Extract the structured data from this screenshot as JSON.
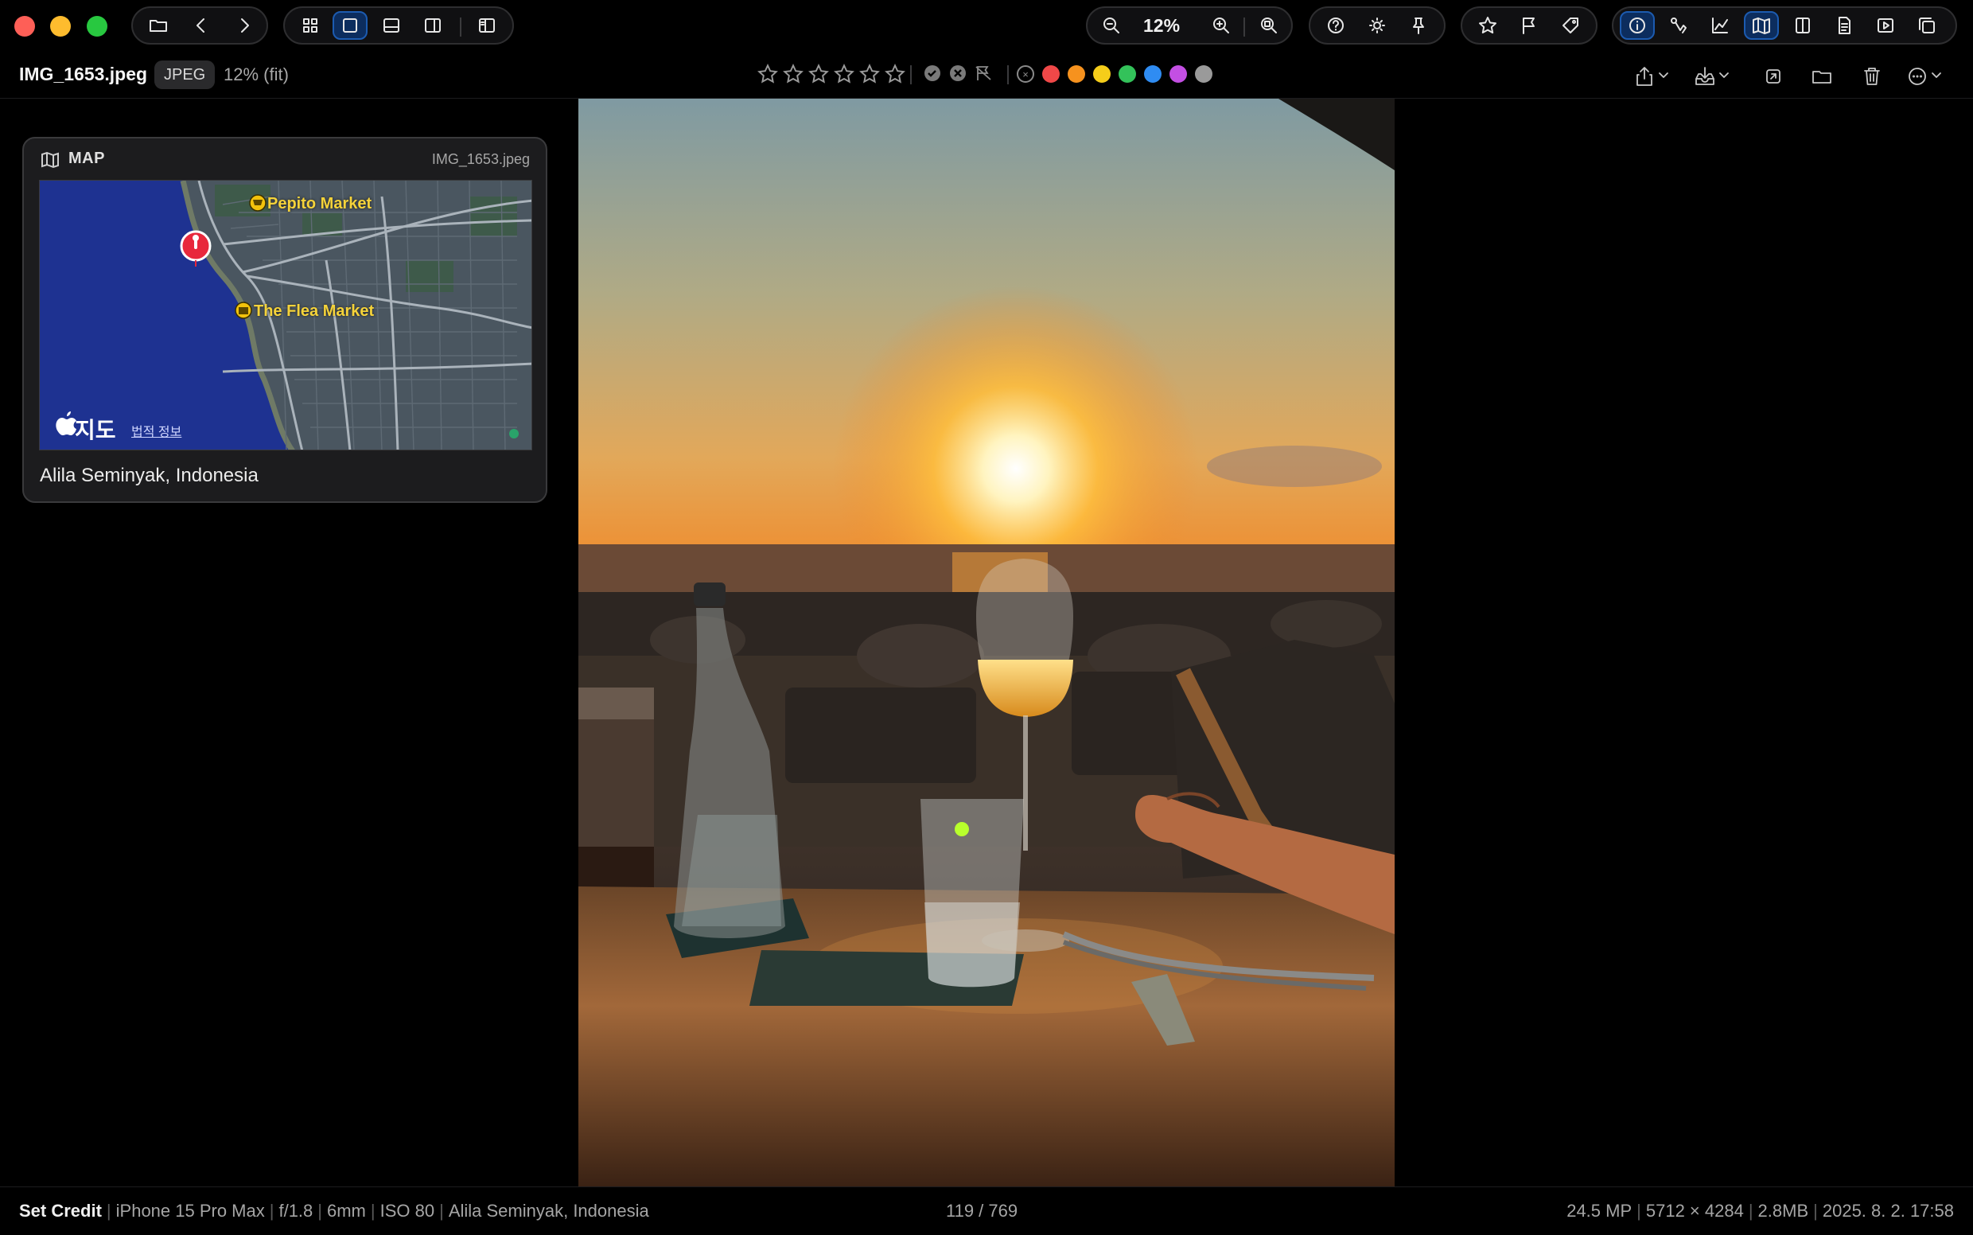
{
  "toolbar": {
    "zoom_label": "12%"
  },
  "info": {
    "filename": "IMG_1653.jpeg",
    "format_badge": "JPEG",
    "zoom_text": "12% (fit)",
    "rating": 0,
    "label_colors": [
      "#f04848",
      "#f6921e",
      "#f5cd1a",
      "#33c25a",
      "#2f8cf2",
      "#c34fe3",
      "#9a9a9a"
    ]
  },
  "map_panel": {
    "title": "MAP",
    "filename": "IMG_1653.jpeg",
    "place1": "Pepito Market",
    "place2": "The Flea Market",
    "maps_brand": "지도",
    "legal_link": "법적 정보",
    "location": "Alila Seminyak, Indonesia"
  },
  "status": {
    "credit": "Set Credit",
    "camera": "iPhone 15 Pro Max",
    "aperture": "f/1.8",
    "focal": "6mm",
    "iso": "ISO 80",
    "location": "Alila Seminyak, Indonesia",
    "position": "119 / 769",
    "megapixels": "24.5 MP",
    "dimensions": "5712 × 4284",
    "filesize": "2.8MB",
    "datetime": "2025. 8. 2. 17:58"
  },
  "colors": {
    "accent": "#1c5bb0",
    "active_bg": "#0c2d5e",
    "ocean": "#1e3291",
    "pin": "#e8283c"
  }
}
